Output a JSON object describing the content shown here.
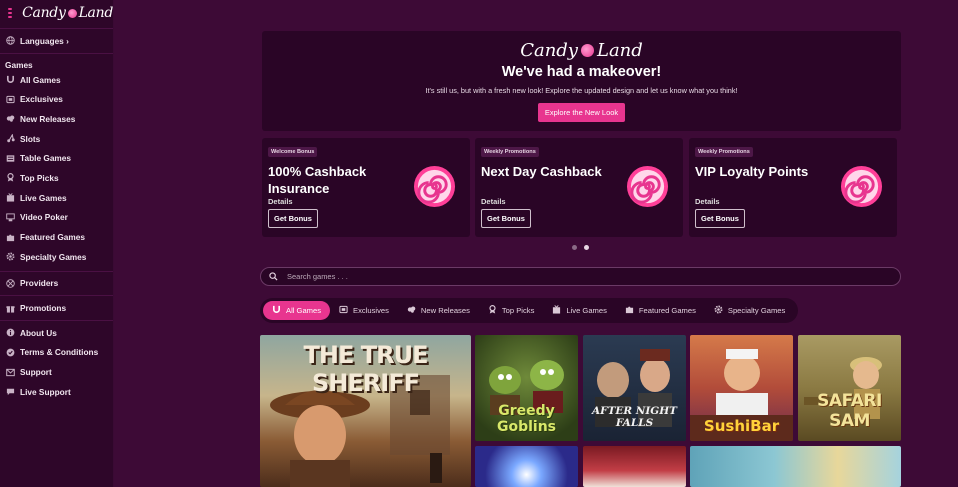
{
  "brand": {
    "name": "Candy Land"
  },
  "sidebar": {
    "languages": "Languages ›",
    "games_heading": "Games",
    "game_items": [
      {
        "label": "All Games",
        "icon": "horseshoe-icon"
      },
      {
        "label": "Exclusives",
        "icon": "exclusives-icon"
      },
      {
        "label": "New Releases",
        "icon": "new-releases-icon"
      },
      {
        "label": "Slots",
        "icon": "cherries-icon"
      },
      {
        "label": "Table Games",
        "icon": "table-icon"
      },
      {
        "label": "Top Picks",
        "icon": "top-picks-icon"
      },
      {
        "label": "Live Games",
        "icon": "live-icon"
      },
      {
        "label": "Video Poker",
        "icon": "video-poker-icon"
      },
      {
        "label": "Featured Games",
        "icon": "puzzle-icon"
      },
      {
        "label": "Specialty Games",
        "icon": "gear-icon"
      }
    ],
    "providers": "Providers",
    "promotions": "Promotions",
    "info_items": [
      {
        "label": "About Us",
        "icon": "info-icon"
      },
      {
        "label": "Terms & Conditions",
        "icon": "terms-icon"
      },
      {
        "label": "Support",
        "icon": "support-icon"
      },
      {
        "label": "Live Support",
        "icon": "live-support-icon"
      }
    ]
  },
  "hero": {
    "title": "We've had a makeover!",
    "subtitle": "It's still us, but with a fresh new look! Explore the updated design and let us know what you think!",
    "cta": "Explore the New Look"
  },
  "promos": [
    {
      "badge": "Welcome Bonus",
      "title": "100% Cashback Insurance",
      "details": "Details",
      "button": "Get Bonus"
    },
    {
      "badge": "Weekly Promotions",
      "title": "Next Day Cashback",
      "details": "Details",
      "button": "Get Bonus"
    },
    {
      "badge": "Weekly Promotions",
      "title": "VIP Loyalty Points",
      "details": "Details",
      "button": "Get Bonus"
    }
  ],
  "carousel": {
    "active_index": 1,
    "count": 2
  },
  "search": {
    "placeholder": "Search games . . ."
  },
  "tabs": [
    {
      "label": "All Games",
      "icon": "horseshoe-icon",
      "active": true
    },
    {
      "label": "Exclusives",
      "icon": "exclusives-icon",
      "active": false
    },
    {
      "label": "New Releases",
      "icon": "new-releases-icon",
      "active": false
    },
    {
      "label": "Top Picks",
      "icon": "top-picks-icon",
      "active": false
    },
    {
      "label": "Live Games",
      "icon": "live-icon",
      "active": false
    },
    {
      "label": "Featured Games",
      "icon": "puzzle-icon",
      "active": false
    },
    {
      "label": "Specialty Games",
      "icon": "gear-icon",
      "active": false
    }
  ],
  "games": [
    {
      "name": "THE TRUE SHERIFF"
    },
    {
      "name": "Greedy Goblins"
    },
    {
      "name": "AFTER NIGHT FALLS"
    },
    {
      "name": "SushiBar"
    },
    {
      "name": "SAFARI SAM"
    },
    {
      "name": ""
    },
    {
      "name": ""
    },
    {
      "name": ""
    }
  ],
  "colors": {
    "accent": "#e8358f",
    "background": "#3d0a36",
    "sidebar": "#2e0629",
    "panel": "#2a0526"
  }
}
